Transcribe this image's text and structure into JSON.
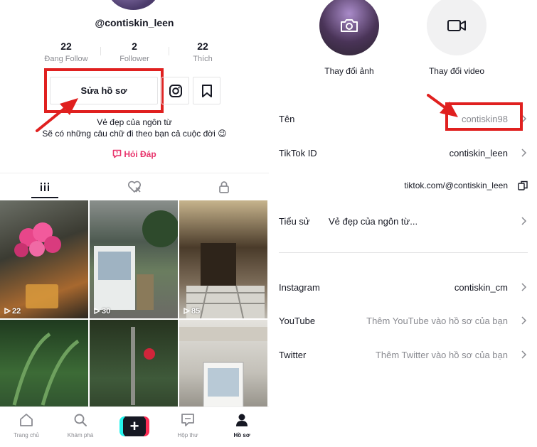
{
  "profile": {
    "username": "@contiskin_leen",
    "stats": [
      {
        "value": "22",
        "label": "Đang Follow"
      },
      {
        "value": "2",
        "label": "Follower"
      },
      {
        "value": "22",
        "label": "Thích"
      }
    ],
    "edit_button": "Sửa hồ sơ",
    "bio_line1": "Vẻ đẹp của ngôn từ",
    "bio_line2": "Sẽ có những câu chữ đi theo bạn cả cuộc đời 😉",
    "qa_link": "Hỏi Đáp",
    "videos": [
      {
        "views": "22"
      },
      {
        "views": "30"
      },
      {
        "views": "85"
      },
      {
        "views": ""
      },
      {
        "views": ""
      },
      {
        "views": ""
      }
    ]
  },
  "bottom_nav": {
    "home": "Trang chủ",
    "discover": "Khám phá",
    "inbox": "Hộp thư",
    "profile": "Hồ sơ"
  },
  "edit_profile": {
    "change_photo": "Thay đổi ảnh",
    "change_video": "Thay đổi video",
    "name_label": "Tên",
    "name_value": "contiskin98",
    "tiktok_id_label": "TikTok ID",
    "tiktok_id_value": "contiskin_leen",
    "profile_link": "tiktok.com/@contiskin_leen",
    "bio_label": "Tiểu sử",
    "bio_value": "Vẻ đẹp của ngôn từ...",
    "instagram_label": "Instagram",
    "instagram_value": "contiskin_cm",
    "youtube_label": "YouTube",
    "youtube_placeholder": "Thêm YouTube vào hồ sơ của bạn",
    "twitter_label": "Twitter",
    "twitter_placeholder": "Thêm Twitter vào hồ sơ của bạn"
  },
  "colors": {
    "annotation_red": "#e0201f",
    "accent_pink": "#e8336b",
    "text_primary": "#161823",
    "text_secondary": "#8a8b91"
  }
}
